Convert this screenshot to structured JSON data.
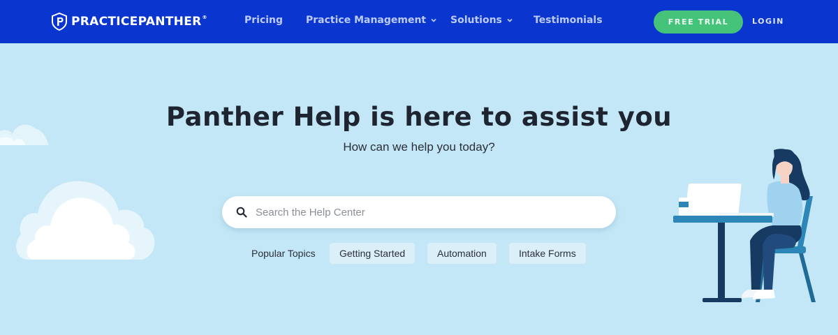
{
  "nav": {
    "logo_text": "PRACTICEPANTHER",
    "logo_mark": "®",
    "links": [
      {
        "label": "Pricing"
      },
      {
        "label": "Practice Management"
      },
      {
        "label": "Solutions"
      },
      {
        "label": "Testimonials"
      }
    ],
    "cta": "FREE TRIAL",
    "login": "LOGIN"
  },
  "hero": {
    "title": "Panther Help is here to assist you",
    "subtitle": "How can we help you today?"
  },
  "search": {
    "placeholder": "Search the Help Center"
  },
  "topics": {
    "label": "Popular Topics",
    "chips": [
      "Getting Started",
      "Automation",
      "Intake Forms"
    ]
  },
  "colors": {
    "nav_bg": "#0a36cf",
    "page_bg": "#c3e7f6",
    "cta_green": "#45c37a",
    "chip_bg": "#dbeff9"
  }
}
